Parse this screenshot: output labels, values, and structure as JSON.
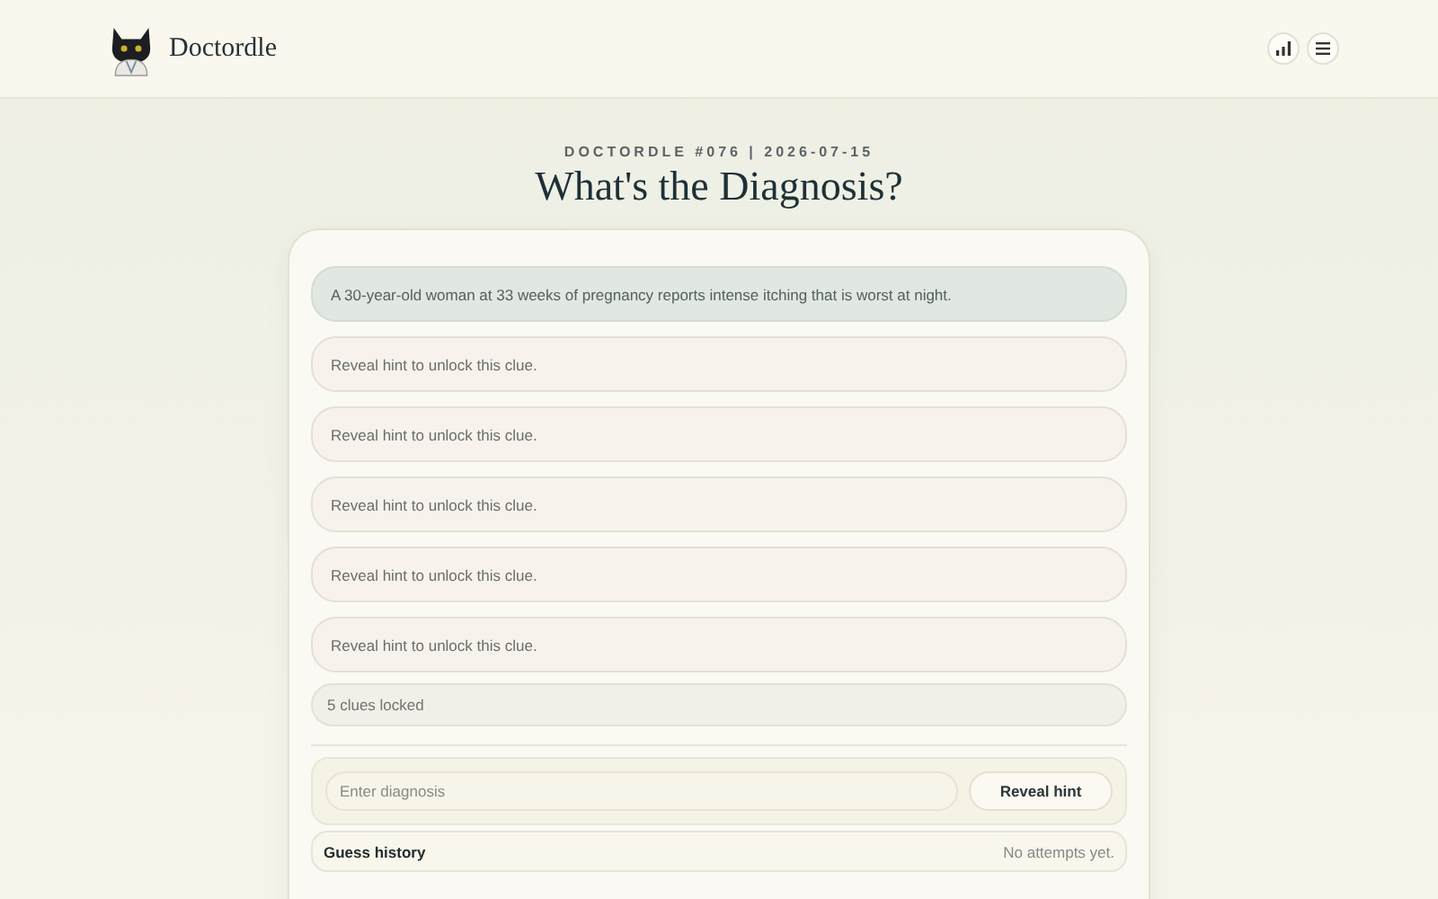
{
  "header": {
    "brand": "Doctordle"
  },
  "puzzle": {
    "label": "DOCTORDLE #076 | 2026-07-15",
    "title": "What's the Diagnosis?"
  },
  "clues": [
    {
      "text": "A 30-year-old woman at 33 weeks of pregnancy reports intense itching that is worst at night.",
      "locked": false
    },
    {
      "text": "Reveal hint to unlock this clue.",
      "locked": true
    },
    {
      "text": "Reveal hint to unlock this clue.",
      "locked": true
    },
    {
      "text": "Reveal hint to unlock this clue.",
      "locked": true
    },
    {
      "text": "Reveal hint to unlock this clue.",
      "locked": true
    },
    {
      "text": "Reveal hint to unlock this clue.",
      "locked": true
    }
  ],
  "locked_summary": "5 clues locked",
  "guess": {
    "placeholder": "Enter diagnosis",
    "button": "Reveal hint"
  },
  "history": {
    "title": "Guess history",
    "status": "No attempts yet."
  }
}
